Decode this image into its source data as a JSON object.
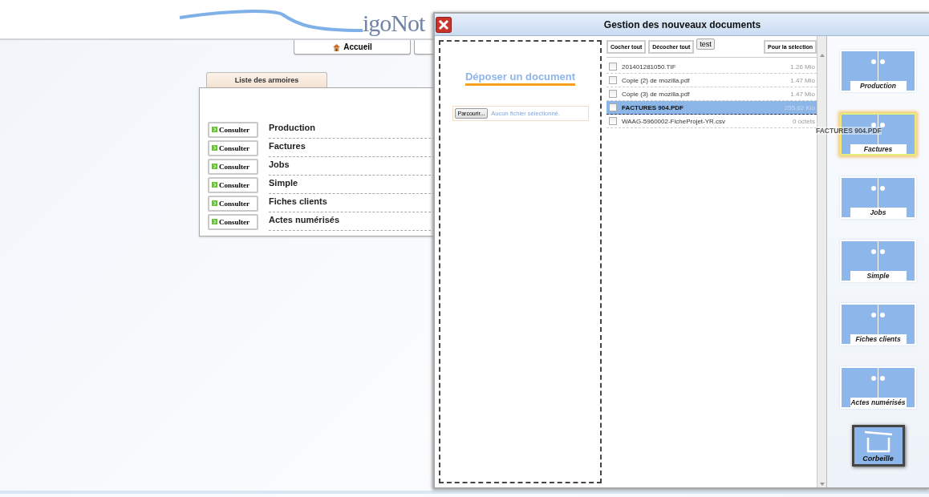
{
  "header": {
    "logo": "igoNot"
  },
  "nav": [
    {
      "label": "Accueil",
      "kind": "home"
    },
    {
      "kind": "blank"
    }
  ],
  "panel": {
    "tab": "Liste des armoires",
    "rows": [
      {
        "button": "Consulter",
        "name": "Production"
      },
      {
        "button": "Consulter",
        "name": "Factures"
      },
      {
        "button": "Consulter",
        "name": "Jobs"
      },
      {
        "button": "Consulter",
        "name": "Simple"
      },
      {
        "button": "Consulter",
        "name": "Fiches clients"
      },
      {
        "button": "Consulter",
        "name": "Actes numérisés"
      }
    ]
  },
  "dialog": {
    "title": "Gestion des nouveaux documents",
    "drop": {
      "heading": "Déposer un document",
      "browse": "Parcourir...",
      "no_file": "Aucun fichier sélectionné."
    },
    "toolbar": [
      {
        "label": "Cocher tout",
        "kind": "bold"
      },
      {
        "label": "Décocher tout",
        "kind": "bold"
      },
      {
        "label": "test",
        "kind": "plain"
      },
      {
        "label": "Pour la sélection",
        "kind": "right"
      }
    ],
    "files": [
      {
        "name": "201401281050.TIF",
        "size": "1.26 Mio",
        "checked": false,
        "selected": false
      },
      {
        "name": "Copie (2) de mozilla.pdf",
        "size": "1.47 Mio",
        "checked": false,
        "selected": false
      },
      {
        "name": "Copie (3) de mozilla.pdf",
        "size": "1.47 Mio",
        "checked": false,
        "selected": false
      },
      {
        "name": "FACTURES 904.PDF",
        "size": "255.62 Kio",
        "checked": false,
        "selected": true
      },
      {
        "name": "WAAG-5960002-FicheProjet-YR.csv",
        "size": "0 octets",
        "checked": false,
        "selected": false
      }
    ],
    "cabinets": [
      {
        "label": "Production",
        "kind": "cabinet",
        "highlighted": false
      },
      {
        "label": "Factures",
        "kind": "cabinet",
        "highlighted": true
      },
      {
        "label": "Jobs",
        "kind": "cabinet",
        "highlighted": false
      },
      {
        "label": "Simple",
        "kind": "cabinet",
        "highlighted": false
      },
      {
        "label": "Fiches clients",
        "kind": "cabinet",
        "highlighted": false
      },
      {
        "label": "Actes numérisés",
        "kind": "cabinet",
        "highlighted": false
      },
      {
        "label": "Corbeille",
        "kind": "trash"
      }
    ],
    "drag_ghost": "FACTURES 904.PDF"
  }
}
